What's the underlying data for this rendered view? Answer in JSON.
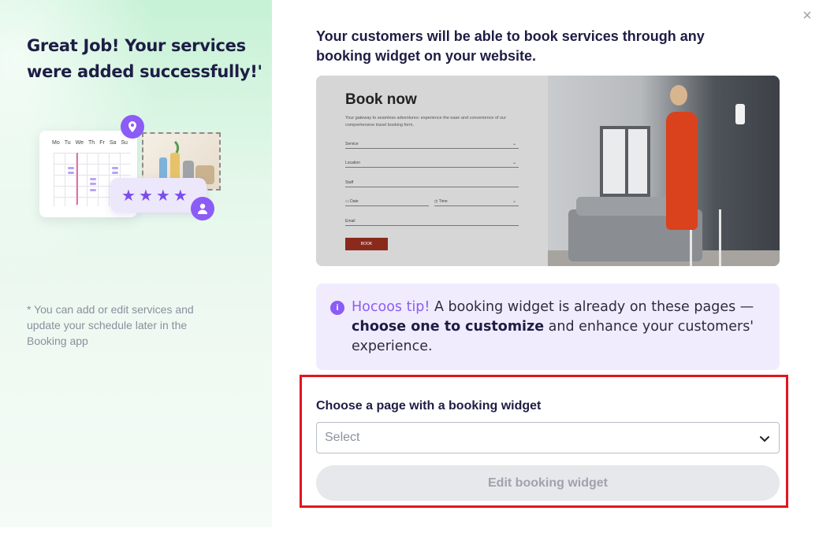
{
  "left": {
    "title": "Great Job! Your services were added successfully!'",
    "note": "* You can add or edit services and update your schedule later in the Booking app",
    "calendar_days": [
      "Mo",
      "Tu",
      "We",
      "Th",
      "Fr",
      "Sa",
      "Su"
    ],
    "rating_stars": 4
  },
  "dialog": {
    "close_label": "×",
    "heading": "Your customers will be able to book services through any booking widget on your website."
  },
  "preview": {
    "form_title": "Book now",
    "form_subtitle": "Your gateway to seamless adventures: experience the ease and convenience of our comprehensive travel booking form.",
    "fields": {
      "service": "Service",
      "location": "Location",
      "staff": "Staff",
      "date": "Date",
      "time": "Time",
      "email": "Email"
    },
    "book_button": "BOOK"
  },
  "tip": {
    "icon": "i",
    "brand": "Hocoos tip!",
    "text_before": " A booking widget is already on these pages — ",
    "bold": "choose one to customize",
    "text_after": " and enhance your customers' experience."
  },
  "widget_picker": {
    "label": "Choose a page with a booking widget",
    "select_placeholder": "Select",
    "edit_button": "Edit booking widget"
  },
  "colors": {
    "accent": "#8b5cf6",
    "highlight_border": "#e0161e",
    "left_panel": "#c6f2d6",
    "tip_bg": "#f1ecfd"
  }
}
